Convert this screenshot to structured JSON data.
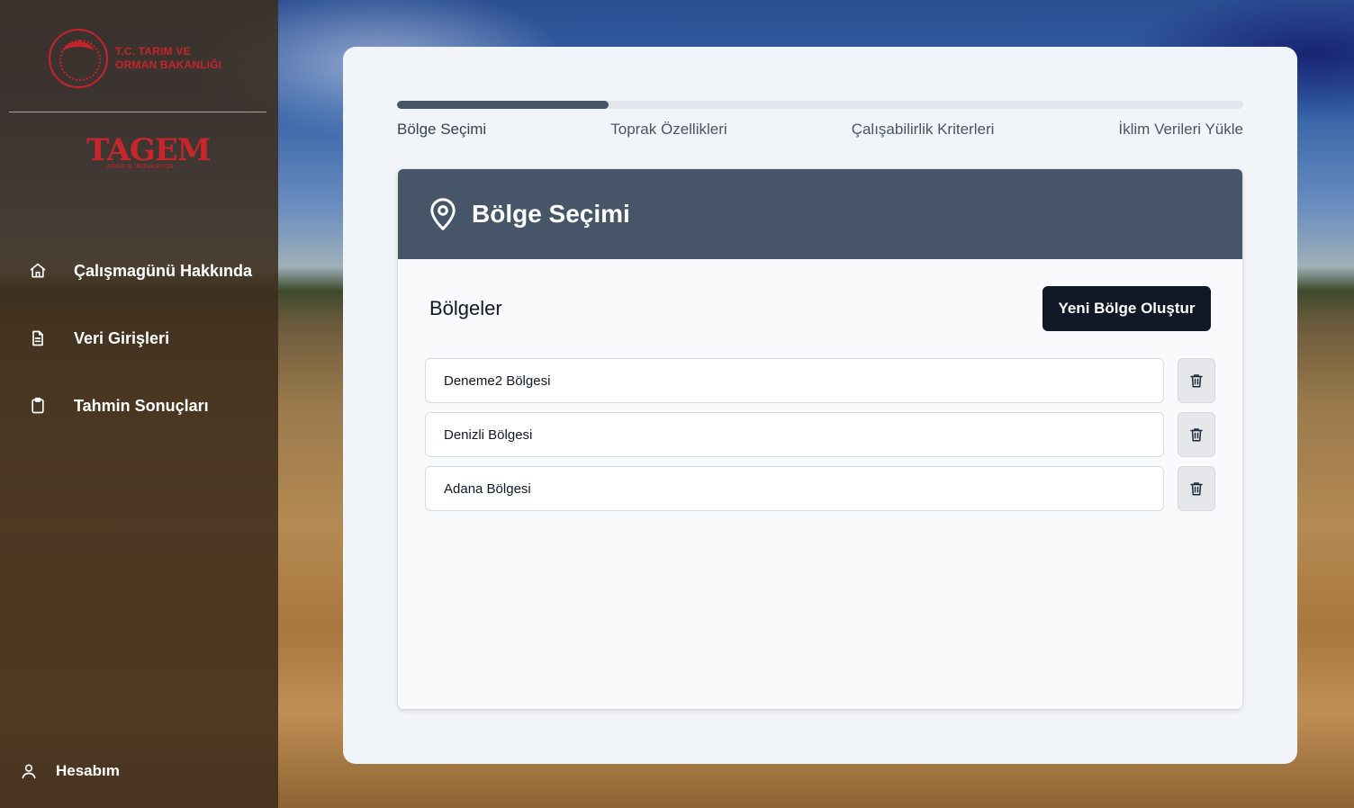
{
  "sidebar": {
    "ministry_line1": "T.C. TARIM VE",
    "ministry_line2": "ORMAN BAKANLIĞI",
    "tagem_logo": "TAGEM",
    "tagem_sub": "ARGE & İNOVASYON",
    "items": [
      {
        "label": "Çalışmagünü Hakkında",
        "icon": "home-icon"
      },
      {
        "label": "Veri Girişleri",
        "icon": "document-icon"
      },
      {
        "label": "Tahmin Sonuçları",
        "icon": "clipboard-icon"
      }
    ],
    "account_label": "Hesabım"
  },
  "wizard": {
    "progress_fraction": 0.25,
    "steps": [
      "Bölge Seçimi",
      "Toprak Özellikleri",
      "Çalışabilirlik Kriterleri",
      "İklim Verileri Yükle"
    ],
    "active_step": 0
  },
  "panel": {
    "title": "Bölge Seçimi",
    "regions_title": "Bölgeler",
    "new_region_button": "Yeni Bölge Oluştur",
    "regions": [
      "Deneme2 Bölgesi",
      "Denizli Bölgesi",
      "Adana Bölgesi"
    ]
  },
  "colors": {
    "sidebar_bg": "#3c2c1c",
    "brand_red": "#c4242b",
    "header_slate": "#475569",
    "button_dark": "#111827"
  }
}
